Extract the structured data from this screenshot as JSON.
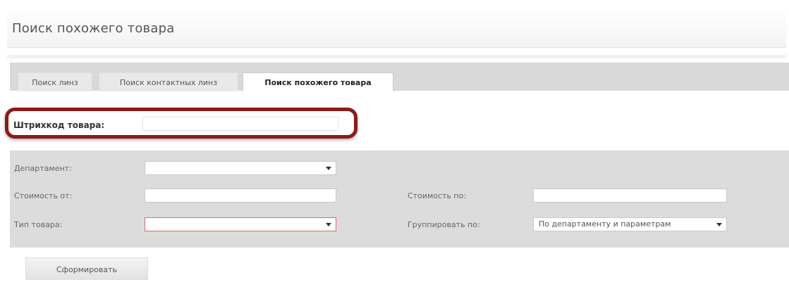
{
  "page": {
    "title": "Поиск похожего товара"
  },
  "tabs": [
    {
      "label": "Поиск линз"
    },
    {
      "label": "Поиск контактных линз"
    },
    {
      "label": "Поиск похожего товара"
    }
  ],
  "barcode": {
    "label": "Штрихкод товара:",
    "value": ""
  },
  "filters": {
    "department": {
      "label": "Департамент:",
      "value": ""
    },
    "price_from": {
      "label": "Стоимость от:",
      "value": ""
    },
    "price_to": {
      "label": "Стоимость по:",
      "value": ""
    },
    "product_type": {
      "label": "Тип товара:",
      "value": ""
    },
    "group_by": {
      "label": "Группировать по:",
      "value": "По департаменту и параметрам"
    }
  },
  "actions": {
    "submit_label": "Сформировать"
  },
  "colors": {
    "highlight": "#8b1a1a",
    "invalid_border": "#e06a6a"
  }
}
